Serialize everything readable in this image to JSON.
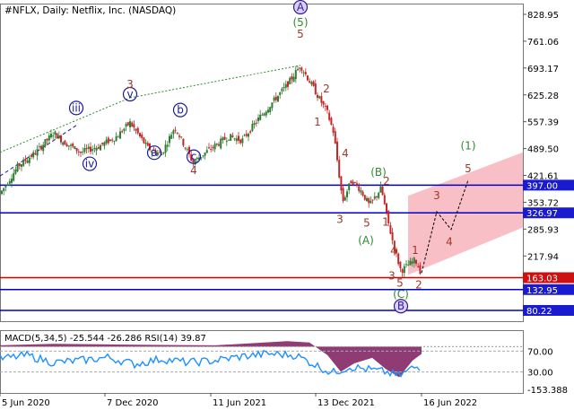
{
  "header": {
    "main_title": "#NFLX, Daily:  Netflix, Inc. (NASDAQ)",
    "indicator_title": "MACD(5,34,5) -25.544 -26.286 RSI(14) 39.87"
  },
  "colors": {
    "up_candle": "#2e7d32",
    "down_candle": "#c62828",
    "wave_red": "#a0372a",
    "wave_blue": "#1a1a9c",
    "wave_green": "#2e8b2e",
    "hline_blue": "#0000cc",
    "hline_red": "#cc0000",
    "channel_fill": "#f8b4bc",
    "price_box_blue": "#1a1ad0",
    "price_box_red": "#d01010",
    "macd_fill": "#7a1a5a",
    "rsi_line": "#1e90ff"
  },
  "chart_data": {
    "type": "line",
    "symbol": "NFLX",
    "timeframe": "Daily",
    "price_axis": {
      "min": 80.22,
      "max": 828.95,
      "ticks": [
        "828.95",
        "761.06",
        "693.17",
        "625.28",
        "557.39",
        "489.50",
        "421.61",
        "353.72",
        "285.93",
        "217.94"
      ]
    },
    "x_axis": {
      "ticks": [
        "5 Jun 2020",
        "7 Dec 2020",
        "11 Jun 2021",
        "13 Dec 2021",
        "16 Jun 2022"
      ]
    },
    "horizontal_levels": [
      {
        "label": "397.00",
        "value": 397.0,
        "color": "blue"
      },
      {
        "label": "326.97",
        "value": 326.97,
        "color": "blue"
      },
      {
        "label": "163.03",
        "value": 163.03,
        "color": "red"
      },
      {
        "label": "132.95",
        "value": 132.95,
        "color": "blue"
      },
      {
        "label": "80.22",
        "value": 80.22,
        "color": "blue"
      }
    ],
    "price_series": [
      {
        "t": 0,
        "p": 375
      },
      {
        "t": 20,
        "p": 445
      },
      {
        "t": 40,
        "p": 480
      },
      {
        "t": 60,
        "p": 530
      },
      {
        "t": 70,
        "p": 508
      },
      {
        "t": 90,
        "p": 480
      },
      {
        "t": 110,
        "p": 495
      },
      {
        "t": 130,
        "p": 520
      },
      {
        "t": 145,
        "p": 555
      },
      {
        "t": 165,
        "p": 490
      },
      {
        "t": 180,
        "p": 475
      },
      {
        "t": 195,
        "p": 545
      },
      {
        "t": 215,
        "p": 455
      },
      {
        "t": 235,
        "p": 490
      },
      {
        "t": 255,
        "p": 520
      },
      {
        "t": 270,
        "p": 510
      },
      {
        "t": 290,
        "p": 570
      },
      {
        "t": 305,
        "p": 610
      },
      {
        "t": 320,
        "p": 650
      },
      {
        "t": 335,
        "p": 700
      },
      {
        "t": 350,
        "p": 640
      },
      {
        "t": 365,
        "p": 580
      },
      {
        "t": 372,
        "p": 530
      },
      {
        "t": 382,
        "p": 355
      },
      {
        "t": 392,
        "p": 410
      },
      {
        "t": 402,
        "p": 385
      },
      {
        "t": 412,
        "p": 345
      },
      {
        "t": 425,
        "p": 390
      },
      {
        "t": 432,
        "p": 310
      },
      {
        "t": 440,
        "p": 235
      },
      {
        "t": 447,
        "p": 180
      },
      {
        "t": 455,
        "p": 195
      },
      {
        "t": 463,
        "p": 208
      },
      {
        "t": 470,
        "p": 172
      }
    ],
    "forecast_path": [
      {
        "t": 470,
        "p": 175
      },
      {
        "t": 487,
        "p": 330
      },
      {
        "t": 503,
        "p": 285
      },
      {
        "t": 522,
        "p": 410
      }
    ],
    "forecast_channel": [
      {
        "t": 455,
        "p": 370
      },
      {
        "t": 583,
        "p": 480
      },
      {
        "t": 583,
        "p": 290
      },
      {
        "t": 455,
        "p": 170
      }
    ],
    "wave_labels": [
      {
        "text": "iii",
        "t": 85,
        "p": 583,
        "style": "blue-circle"
      },
      {
        "text": "iv",
        "t": 100,
        "p": 442,
        "style": "blue-circle"
      },
      {
        "text": "v",
        "t": 145,
        "p": 618,
        "style": "blue-circle"
      },
      {
        "text": "3",
        "t": 145,
        "p": 643,
        "style": "red"
      },
      {
        "text": "a",
        "t": 172,
        "p": 470,
        "style": "blue-circle"
      },
      {
        "text": "b",
        "t": 201,
        "p": 578,
        "style": "blue-circle"
      },
      {
        "text": "c",
        "t": 216,
        "p": 460,
        "style": "blue-circle"
      },
      {
        "text": "4",
        "t": 216,
        "p": 425,
        "style": "red"
      },
      {
        "text": "A",
        "t": 335,
        "p": 838,
        "style": "purple-circle"
      },
      {
        "text": "(5)",
        "t": 335,
        "p": 800,
        "style": "green"
      },
      {
        "text": "5",
        "t": 335,
        "p": 770,
        "style": "red"
      },
      {
        "text": "2",
        "t": 364,
        "p": 632,
        "style": "red"
      },
      {
        "text": "1",
        "t": 354,
        "p": 548,
        "style": "red"
      },
      {
        "text": "4",
        "t": 385,
        "p": 468,
        "style": "red"
      },
      {
        "text": "3",
        "t": 379,
        "p": 302,
        "style": "red"
      },
      {
        "text": "(B)",
        "t": 422,
        "p": 420,
        "style": "green"
      },
      {
        "text": "2",
        "t": 431,
        "p": 398,
        "style": "red"
      },
      {
        "text": "5",
        "t": 409,
        "p": 292,
        "style": "red"
      },
      {
        "text": "1",
        "t": 430,
        "p": 295,
        "style": "red"
      },
      {
        "text": "(A)",
        "t": 408,
        "p": 248,
        "style": "green"
      },
      {
        "text": "4",
        "t": 439,
        "p": 222,
        "style": "red"
      },
      {
        "text": "1",
        "t": 463,
        "p": 223,
        "style": "red"
      },
      {
        "text": "3",
        "t": 437,
        "p": 158,
        "style": "red"
      },
      {
        "text": "5",
        "t": 446,
        "p": 140,
        "style": "red"
      },
      {
        "text": "2",
        "t": 467,
        "p": 136,
        "style": "red"
      },
      {
        "text": "(C)",
        "t": 447,
        "p": 112,
        "style": "green"
      },
      {
        "text": "B",
        "t": 447,
        "p": 82,
        "style": "purple-circle"
      },
      {
        "text": "(1)",
        "t": 522,
        "p": 488,
        "style": "green"
      },
      {
        "text": "5",
        "t": 522,
        "p": 430,
        "style": "red"
      },
      {
        "text": "3",
        "t": 487,
        "p": 362,
        "style": "red"
      },
      {
        "text": "4",
        "t": 501,
        "p": 245,
        "style": "red"
      }
    ],
    "indicator": {
      "macd_params": "5,34,5",
      "macd_main": -25.544,
      "macd_signal": -26.286,
      "rsi_period": 14,
      "rsi_value": 39.87,
      "axis_ticks": [
        "70.00",
        "30.00",
        "-153.388"
      ],
      "rsi_series": [
        {
          "t": 0,
          "v": 55
        },
        {
          "t": 30,
          "v": 62
        },
        {
          "t": 60,
          "v": 48
        },
        {
          "t": 90,
          "v": 52
        },
        {
          "t": 120,
          "v": 58
        },
        {
          "t": 150,
          "v": 45
        },
        {
          "t": 180,
          "v": 55
        },
        {
          "t": 210,
          "v": 48
        },
        {
          "t": 240,
          "v": 52
        },
        {
          "t": 270,
          "v": 60
        },
        {
          "t": 300,
          "v": 65
        },
        {
          "t": 330,
          "v": 62
        },
        {
          "t": 350,
          "v": 45
        },
        {
          "t": 370,
          "v": 28
        },
        {
          "t": 390,
          "v": 40
        },
        {
          "t": 410,
          "v": 35
        },
        {
          "t": 430,
          "v": 30
        },
        {
          "t": 445,
          "v": 22
        },
        {
          "t": 460,
          "v": 38
        },
        {
          "t": 470,
          "v": 40
        }
      ],
      "macd_series": [
        {
          "t": 0,
          "v": 5
        },
        {
          "t": 60,
          "v": 10
        },
        {
          "t": 120,
          "v": 8
        },
        {
          "t": 180,
          "v": 6
        },
        {
          "t": 240,
          "v": 5
        },
        {
          "t": 280,
          "v": 12
        },
        {
          "t": 320,
          "v": 20
        },
        {
          "t": 345,
          "v": 15
        },
        {
          "t": 365,
          "v": -30
        },
        {
          "t": 380,
          "v": -90
        },
        {
          "t": 395,
          "v": -60
        },
        {
          "t": 415,
          "v": -40
        },
        {
          "t": 430,
          "v": -80
        },
        {
          "t": 445,
          "v": -110
        },
        {
          "t": 460,
          "v": -50
        },
        {
          "t": 470,
          "v": -26
        }
      ]
    }
  }
}
